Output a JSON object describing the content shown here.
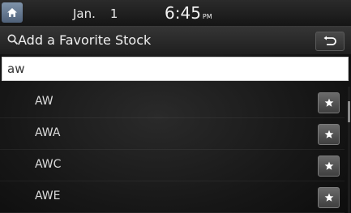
{
  "statusbar": {
    "month": "Jan.",
    "day": "1",
    "time": "6:45",
    "ampm": "PM"
  },
  "header": {
    "title": "Add a Favorite Stock"
  },
  "search": {
    "value": "aw"
  },
  "results": [
    {
      "label": "AW"
    },
    {
      "label": "AWA"
    },
    {
      "label": "AWC"
    },
    {
      "label": "AWE"
    }
  ]
}
